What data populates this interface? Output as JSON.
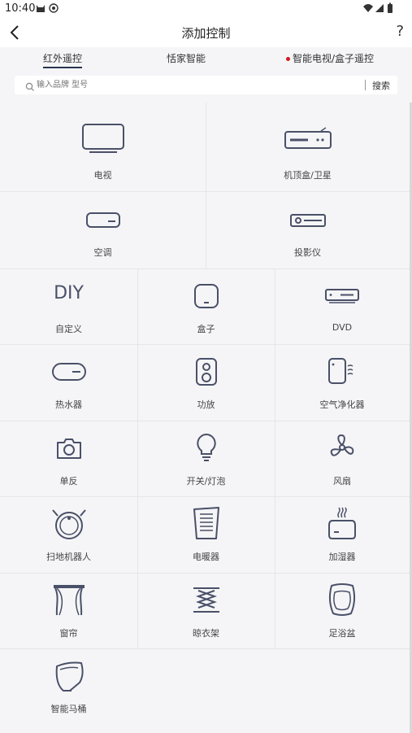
{
  "status": {
    "time": "10:40"
  },
  "header": {
    "title": "添加控制",
    "help": "?"
  },
  "tabs": [
    {
      "label": "红外遥控",
      "active": true
    },
    {
      "label": "恬家智能",
      "active": false
    },
    {
      "label": "智能电视/盒子遥控",
      "active": false,
      "dot": true
    }
  ],
  "search": {
    "placeholder": "输入品牌 型号",
    "button": "搜索"
  },
  "devices": [
    {
      "label": "电视",
      "icon": "tv-icon"
    },
    {
      "label": "机顶盒/卫星",
      "icon": "set-top-box-icon"
    },
    {
      "label": "空调",
      "icon": "air-conditioner-icon"
    },
    {
      "label": "投影仪",
      "icon": "projector-icon"
    },
    {
      "label": "自定义",
      "icon": "diy-icon",
      "icon_text": "DIY"
    },
    {
      "label": "盒子",
      "icon": "box-icon"
    },
    {
      "label": "DVD",
      "icon": "dvd-icon"
    },
    {
      "label": "热水器",
      "icon": "water-heater-icon"
    },
    {
      "label": "功放",
      "icon": "speaker-icon"
    },
    {
      "label": "空气净化器",
      "icon": "air-purifier-icon"
    },
    {
      "label": "单反",
      "icon": "camera-icon"
    },
    {
      "label": "开关/灯泡",
      "icon": "bulb-icon"
    },
    {
      "label": "风扇",
      "icon": "fan-icon"
    },
    {
      "label": "扫地机器人",
      "icon": "robot-vacuum-icon"
    },
    {
      "label": "电暖器",
      "icon": "heater-icon"
    },
    {
      "label": "加湿器",
      "icon": "humidifier-icon"
    },
    {
      "label": "窗帘",
      "icon": "curtain-icon"
    },
    {
      "label": "晾衣架",
      "icon": "clothes-rack-icon"
    },
    {
      "label": "足浴盆",
      "icon": "foot-bath-icon"
    },
    {
      "label": "智能马桶",
      "icon": "smart-toilet-icon"
    }
  ],
  "colors": {
    "icon": "#4a5068",
    "accent": "#2a3550",
    "dot": "#d0181f",
    "background": "#f5f5f7"
  }
}
